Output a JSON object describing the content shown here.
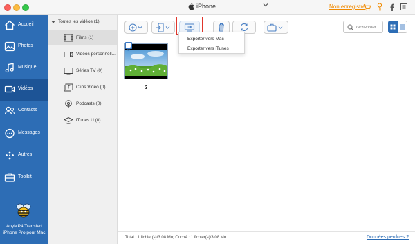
{
  "titlebar": {
    "device_name": "iPhone",
    "not_registered": "Non enregistré",
    "icons": [
      "cart-icon",
      "key-icon",
      "facebook-icon",
      "menu-icon",
      "minimize-icon",
      "close-icon"
    ]
  },
  "sidebar": {
    "items": [
      {
        "label": "Accueil",
        "icon": "home-icon",
        "active": false
      },
      {
        "label": "Photos",
        "icon": "photos-icon",
        "active": false
      },
      {
        "label": "Musique",
        "icon": "music-icon",
        "active": false
      },
      {
        "label": "Vidéos",
        "icon": "video-icon",
        "active": true
      },
      {
        "label": "Contacts",
        "icon": "contacts-icon",
        "active": false
      },
      {
        "label": "Messages",
        "icon": "messages-icon",
        "active": false
      },
      {
        "label": "Autres",
        "icon": "others-icon",
        "active": false
      },
      {
        "label": "Toolkit",
        "icon": "toolkit-icon",
        "active": false
      }
    ],
    "brand_line1": "AnyMP4 Transfert",
    "brand_line2": "iPhone Pro pour Mac"
  },
  "categories": {
    "header": "Toutes les vidéos (1)",
    "items": [
      {
        "label": "Films (1)",
        "icon": "film-icon",
        "active": true
      },
      {
        "label": "Vidéos personnell...",
        "icon": "camera-icon",
        "active": false
      },
      {
        "label": "Séries TV (0)",
        "icon": "tv-icon",
        "active": false
      },
      {
        "label": "Clips Vidéo (0)",
        "icon": "clip-icon",
        "active": false
      },
      {
        "label": "Podcasts (0)",
        "icon": "podcast-icon",
        "active": false
      },
      {
        "label": "iTunes U (0)",
        "icon": "itunes-u-icon",
        "active": false
      }
    ]
  },
  "toolbar": {
    "search_placeholder": "rechercher"
  },
  "export_menu": {
    "items": [
      "Exporter vers Mac",
      "Exporter vers iTunes"
    ]
  },
  "content": {
    "item_label": "3"
  },
  "status": {
    "text": "Total : 1 fichier(s)/3.08 Mo; Coché : 1 fichier(s)/3.08 Mo",
    "lost_data": "Données perdues ?"
  },
  "colors": {
    "sidebar": "#2d6db5",
    "sidebar_active": "#1d5496",
    "accent_orange": "#f08a00",
    "highlight_red": "#e0362c"
  }
}
